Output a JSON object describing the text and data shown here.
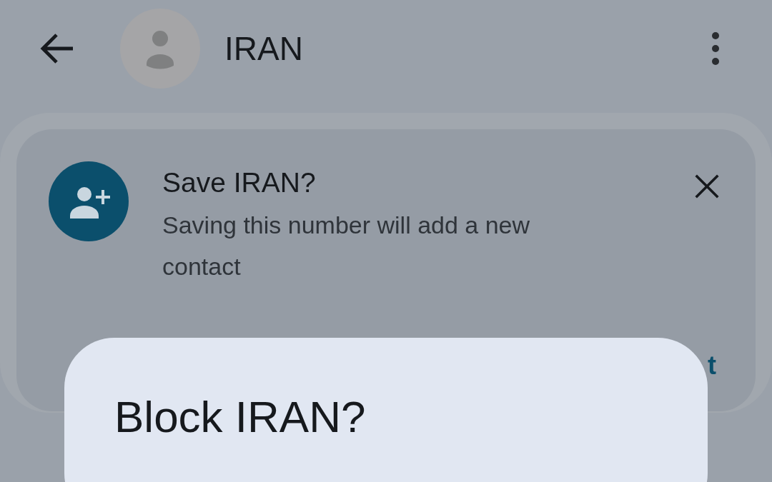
{
  "app_bar": {
    "title": "IRAN"
  },
  "save_card": {
    "title": "Save IRAN?",
    "message": "Saving this number will add a new contact",
    "action": "t"
  },
  "dialog": {
    "title": "Block IRAN?"
  }
}
